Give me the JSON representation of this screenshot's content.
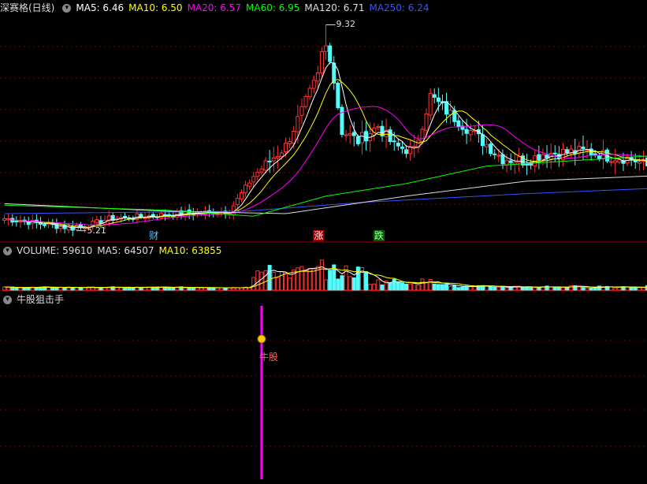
{
  "header": {
    "stock_name": "深赛格(日线)",
    "ma_labels": [
      {
        "text": "MA5: 6.46",
        "color": "#ffffff"
      },
      {
        "text": "MA10: 6.50",
        "color": "#ffff00"
      },
      {
        "text": "MA20: 6.57",
        "color": "#ff00ff"
      },
      {
        "text": "MA60: 6.95",
        "color": "#00ff00"
      },
      {
        "text": "MA120: 6.71",
        "color": "#dddddd"
      },
      {
        "text": "MA250: 6.24",
        "color": "#3355ff"
      }
    ]
  },
  "volume_header": {
    "items": [
      {
        "text": "VOLUME: 59610",
        "color": "#dddddd"
      },
      {
        "text": "MA5: 64507",
        "color": "#dddddd"
      },
      {
        "text": "MA10: 63855",
        "color": "#ffff00"
      }
    ]
  },
  "indicator_header": {
    "title": "牛股狙击手"
  },
  "annotations": {
    "low_label": "5.21",
    "high_label": "9.32",
    "tag_cai": "财",
    "tag_zhang": "涨",
    "tag_die": "跌",
    "signal_label": "牛股"
  },
  "colors": {
    "up": "#ff3232",
    "down": "#54fcfc",
    "grid": "#800000",
    "signal": "#ff00ff"
  },
  "chart_data": {
    "type": "candlestick",
    "price_ylim": [
      5.0,
      9.5
    ],
    "volume_ylim": [
      0,
      130000
    ],
    "indicator_ylim": [
      0,
      1
    ],
    "seed": 7,
    "segments": [
      [
        0,
        5.45
      ],
      [
        18,
        5.25
      ],
      [
        26,
        5.45
      ],
      [
        44,
        5.55
      ],
      [
        56,
        5.6
      ],
      [
        62,
        6.3
      ],
      [
        70,
        6.9
      ],
      [
        78,
        8.3
      ],
      [
        80,
        9.2
      ],
      [
        84,
        7.2
      ],
      [
        88,
        7.0
      ],
      [
        93,
        7.3
      ],
      [
        97,
        6.9
      ],
      [
        102,
        6.8
      ],
      [
        106,
        7.9
      ],
      [
        110,
        7.6
      ],
      [
        116,
        7.2
      ],
      [
        124,
        6.65
      ],
      [
        130,
        6.6
      ],
      [
        134,
        6.75
      ],
      [
        145,
        6.8
      ],
      [
        150,
        6.7
      ],
      [
        156,
        6.65
      ],
      [
        160,
        6.5
      ]
    ],
    "ma_lines": [
      {
        "name": "MA250",
        "color": "#3355ff",
        "points": [
          [
            0,
            5.55
          ],
          [
            60,
            5.6
          ],
          [
            90,
            5.78
          ],
          [
            130,
            5.95
          ],
          [
            160,
            6.05
          ]
        ]
      },
      {
        "name": "MA120",
        "color": "#dddddd",
        "points": [
          [
            0,
            5.75
          ],
          [
            40,
            5.6
          ],
          [
            70,
            5.55
          ],
          [
            100,
            5.9
          ],
          [
            130,
            6.2
          ],
          [
            160,
            6.3
          ]
        ]
      },
      {
        "name": "MA60",
        "color": "#00ff00",
        "points": [
          [
            0,
            5.72
          ],
          [
            40,
            5.62
          ],
          [
            62,
            5.5
          ],
          [
            80,
            5.9
          ],
          [
            100,
            6.15
          ],
          [
            120,
            6.5
          ],
          [
            140,
            6.6
          ],
          [
            160,
            6.7
          ]
        ]
      }
    ],
    "low_index": 18,
    "high_index": 80,
    "signal_index": 64,
    "tag_indices": {
      "cai": 37,
      "zhang": 78,
      "die": 93
    }
  }
}
